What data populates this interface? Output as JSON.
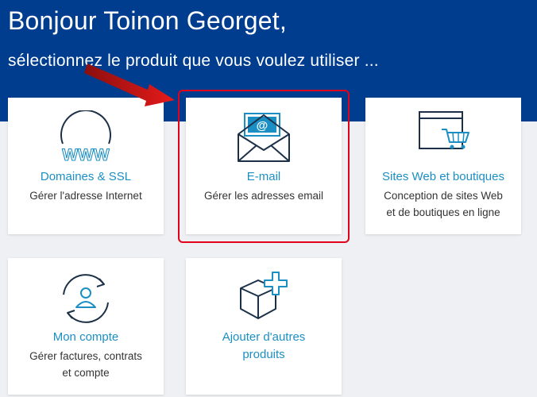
{
  "header": {
    "greeting": "Bonjour Toinon Georget,",
    "subtitle": "sélectionnez le produit que vous voulez utiliser ..."
  },
  "products": [
    {
      "title": "Domaines & SSL",
      "desc1": "Gérer l'adresse Internet",
      "desc2": "",
      "icon": "globe-www-icon"
    },
    {
      "title": "E-mail",
      "desc1": "Gérer les adresses email",
      "desc2": "",
      "icon": "envelope-icon"
    },
    {
      "title": "Sites Web et boutiques",
      "desc1": "Conception de sites Web",
      "desc2": "et de boutiques en ligne",
      "icon": "website-cart-icon"
    },
    {
      "title": "Mon compte",
      "desc1": "Gérer factures, contrats",
      "desc2": "et compte",
      "icon": "account-user-icon"
    },
    {
      "title1": "Ajouter d'autres",
      "title2": "produits",
      "icon": "box-plus-icon"
    }
  ],
  "colors": {
    "header_bg": "#003d8f",
    "link": "#1b8fc4",
    "icon_dark": "#1c3148",
    "icon_accent": "#1b8fc4",
    "highlight": "#e3001b"
  }
}
